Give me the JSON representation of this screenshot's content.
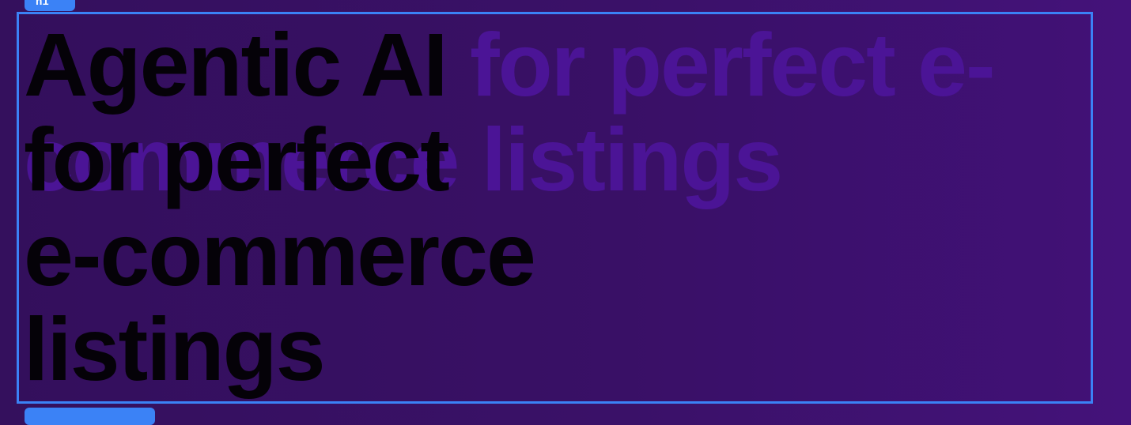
{
  "overlay": {
    "top_tag": "h1",
    "bottom_tag": ""
  },
  "headline": {
    "ghost_text": "Agentic AI for perfect e-commerce listings",
    "main_text": "Agentic AI\nfor perfect\ne-commerce\nlistings"
  },
  "colors": {
    "background_start": "#34105d",
    "background_end": "#44127a",
    "selection_accent": "#3b82f6",
    "ghost_text": "#4b1496",
    "main_text": "#050208"
  }
}
